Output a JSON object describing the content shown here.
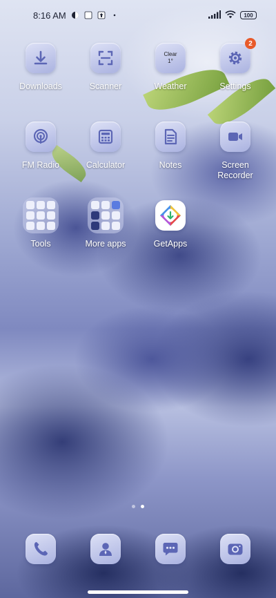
{
  "status": {
    "time": "8:16 AM",
    "battery": "100"
  },
  "apps": [
    {
      "label": "Downloads",
      "icon": "download-icon"
    },
    {
      "label": "Scanner",
      "icon": "scanner-icon"
    },
    {
      "label": "Weather",
      "icon": "weather-icon",
      "weather_line1": "Clear",
      "weather_line2": "1°"
    },
    {
      "label": "Settings",
      "icon": "gear-icon",
      "badge": "2"
    },
    {
      "label": "FM Radio",
      "icon": "radio-icon"
    },
    {
      "label": "Calculator",
      "icon": "calculator-icon"
    },
    {
      "label": "Notes",
      "icon": "notes-icon"
    },
    {
      "label": "Screen Recorder",
      "icon": "video-camera-icon"
    },
    {
      "label": "Tools",
      "icon": "folder-icon"
    },
    {
      "label": "More apps",
      "icon": "folder-icon"
    },
    {
      "label": "GetApps",
      "icon": "getapps-icon"
    }
  ],
  "dock": [
    {
      "icon": "phone-icon"
    },
    {
      "icon": "contacts-icon"
    },
    {
      "icon": "messages-icon"
    },
    {
      "icon": "camera-icon"
    }
  ],
  "page_indicator": {
    "pages": 2,
    "active": 2
  },
  "colors": {
    "badge": "#e85a2a",
    "icon_tile": "#c3c9ec",
    "icon_glyph": "#5c66b5"
  }
}
